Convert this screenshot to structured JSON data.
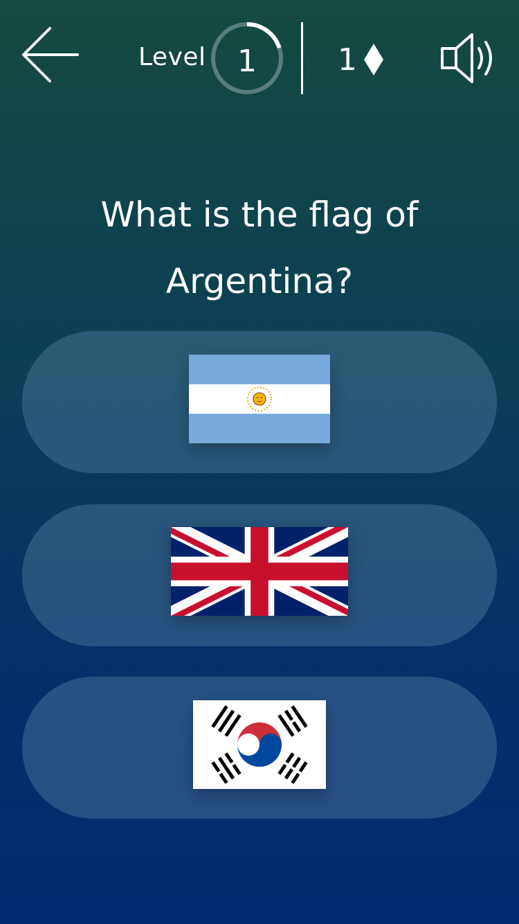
{
  "header": {
    "level_label": "Level",
    "level_number": "1",
    "level_progress": 0.2,
    "gems_count": "1",
    "icons": [
      "back-arrow-icon",
      "diamond-icon",
      "speaker-icon"
    ]
  },
  "question": {
    "line1": "What is the flag of",
    "line2": "Argentina?"
  },
  "options": [
    {
      "flag": "Argentina"
    },
    {
      "flag": "United Kingdom"
    },
    {
      "flag": "South Korea"
    }
  ],
  "colors": {
    "bg_top": "#154a40",
    "bg_bottom": "#032a70",
    "option_bg": "rgba(94,136,172,0.38)",
    "ring_track": "#5a7e80",
    "ring_progress": "#ffffff"
  }
}
